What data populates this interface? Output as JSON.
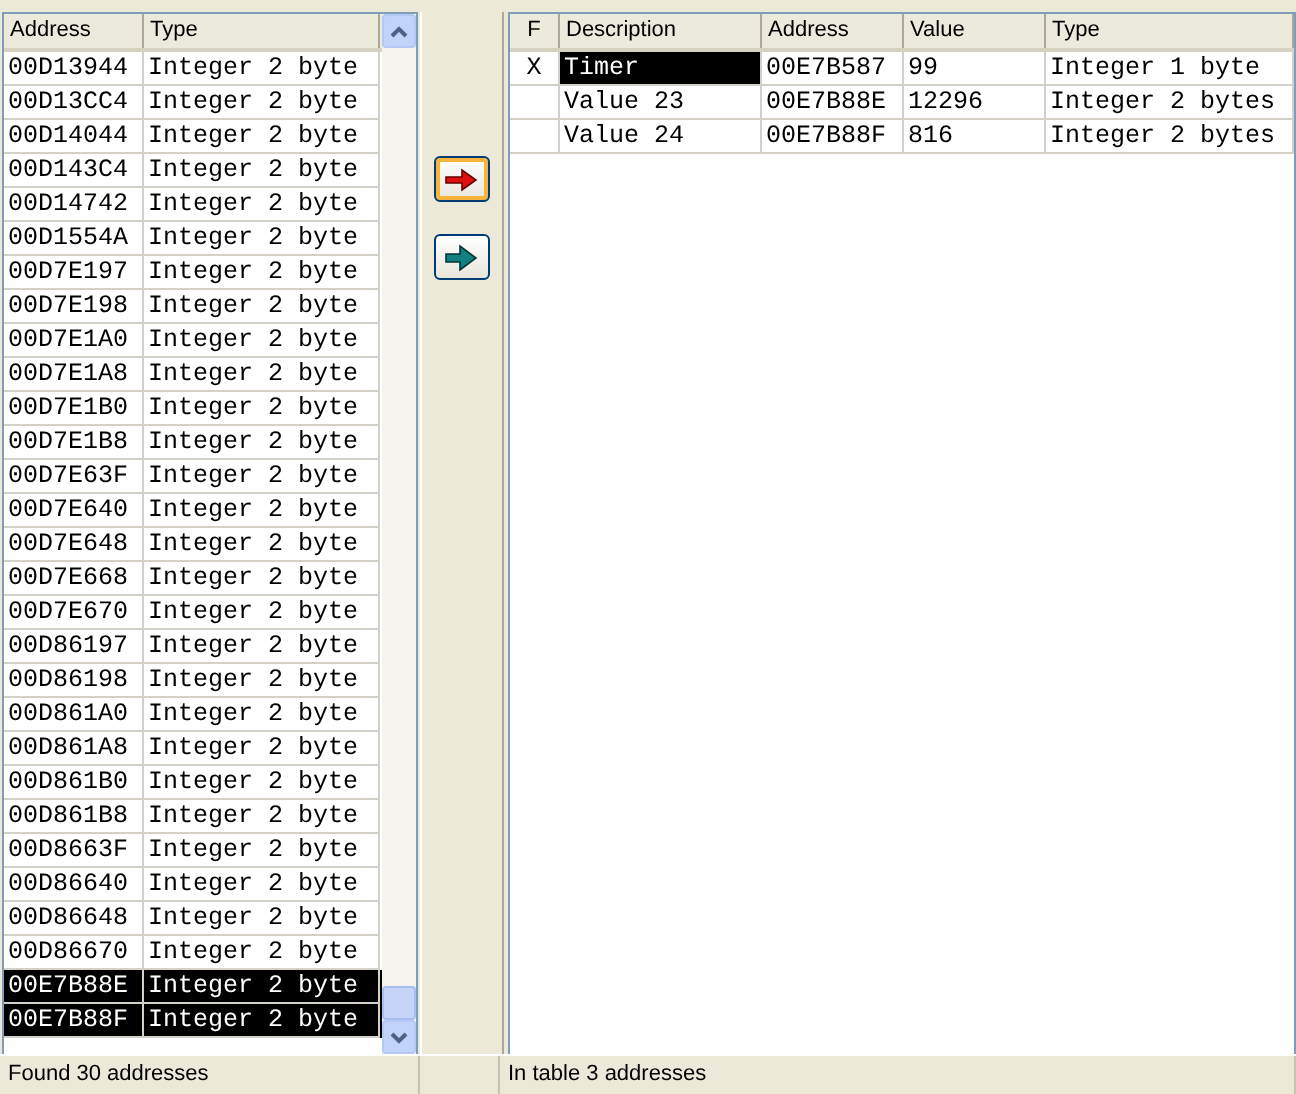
{
  "found_list": {
    "columns": [
      "Address",
      "Type"
    ],
    "rows": [
      {
        "address": "00D13944",
        "type": "Integer 2 byte",
        "selected": false
      },
      {
        "address": "00D13CC4",
        "type": "Integer 2 byte",
        "selected": false
      },
      {
        "address": "00D14044",
        "type": "Integer 2 byte",
        "selected": false
      },
      {
        "address": "00D143C4",
        "type": "Integer 2 byte",
        "selected": false
      },
      {
        "address": "00D14742",
        "type": "Integer 2 byte",
        "selected": false
      },
      {
        "address": "00D1554A",
        "type": "Integer 2 byte",
        "selected": false
      },
      {
        "address": "00D7E197",
        "type": "Integer 2 byte",
        "selected": false
      },
      {
        "address": "00D7E198",
        "type": "Integer 2 byte",
        "selected": false
      },
      {
        "address": "00D7E1A0",
        "type": "Integer 2 byte",
        "selected": false
      },
      {
        "address": "00D7E1A8",
        "type": "Integer 2 byte",
        "selected": false
      },
      {
        "address": "00D7E1B0",
        "type": "Integer 2 byte",
        "selected": false
      },
      {
        "address": "00D7E1B8",
        "type": "Integer 2 byte",
        "selected": false
      },
      {
        "address": "00D7E63F",
        "type": "Integer 2 byte",
        "selected": false
      },
      {
        "address": "00D7E640",
        "type": "Integer 2 byte",
        "selected": false
      },
      {
        "address": "00D7E648",
        "type": "Integer 2 byte",
        "selected": false
      },
      {
        "address": "00D7E668",
        "type": "Integer 2 byte",
        "selected": false
      },
      {
        "address": "00D7E670",
        "type": "Integer 2 byte",
        "selected": false
      },
      {
        "address": "00D86197",
        "type": "Integer 2 byte",
        "selected": false
      },
      {
        "address": "00D86198",
        "type": "Integer 2 byte",
        "selected": false
      },
      {
        "address": "00D861A0",
        "type": "Integer 2 byte",
        "selected": false
      },
      {
        "address": "00D861A8",
        "type": "Integer 2 byte",
        "selected": false
      },
      {
        "address": "00D861B0",
        "type": "Integer 2 byte",
        "selected": false
      },
      {
        "address": "00D861B8",
        "type": "Integer 2 byte",
        "selected": false
      },
      {
        "address": "00D8663F",
        "type": "Integer 2 byte",
        "selected": false
      },
      {
        "address": "00D86640",
        "type": "Integer 2 byte",
        "selected": false
      },
      {
        "address": "00D86648",
        "type": "Integer 2 byte",
        "selected": false
      },
      {
        "address": "00D86670",
        "type": "Integer 2 byte",
        "selected": false
      },
      {
        "address": "00E7B88E",
        "type": "Integer 2 byte",
        "selected": true
      },
      {
        "address": "00E7B88F",
        "type": "Integer 2 byte",
        "selected": true
      }
    ],
    "status": "Found 30 addresses"
  },
  "address_table": {
    "columns": [
      "F",
      "Description",
      "Address",
      "Value",
      "Type"
    ],
    "rows": [
      {
        "flag": "X",
        "description": "Timer",
        "address": "00E7B587",
        "value": "99",
        "type": "Integer 1 byte",
        "selected": true
      },
      {
        "description": "Value 23",
        "address": "00E7B88E",
        "value": "12296",
        "type": "Integer 2 bytes",
        "selected": false
      },
      {
        "description": "Value 24",
        "address": "00E7B88F",
        "value": "816",
        "type": "Integer 2 bytes",
        "selected": false
      }
    ],
    "status": "In table 3 addresses"
  }
}
